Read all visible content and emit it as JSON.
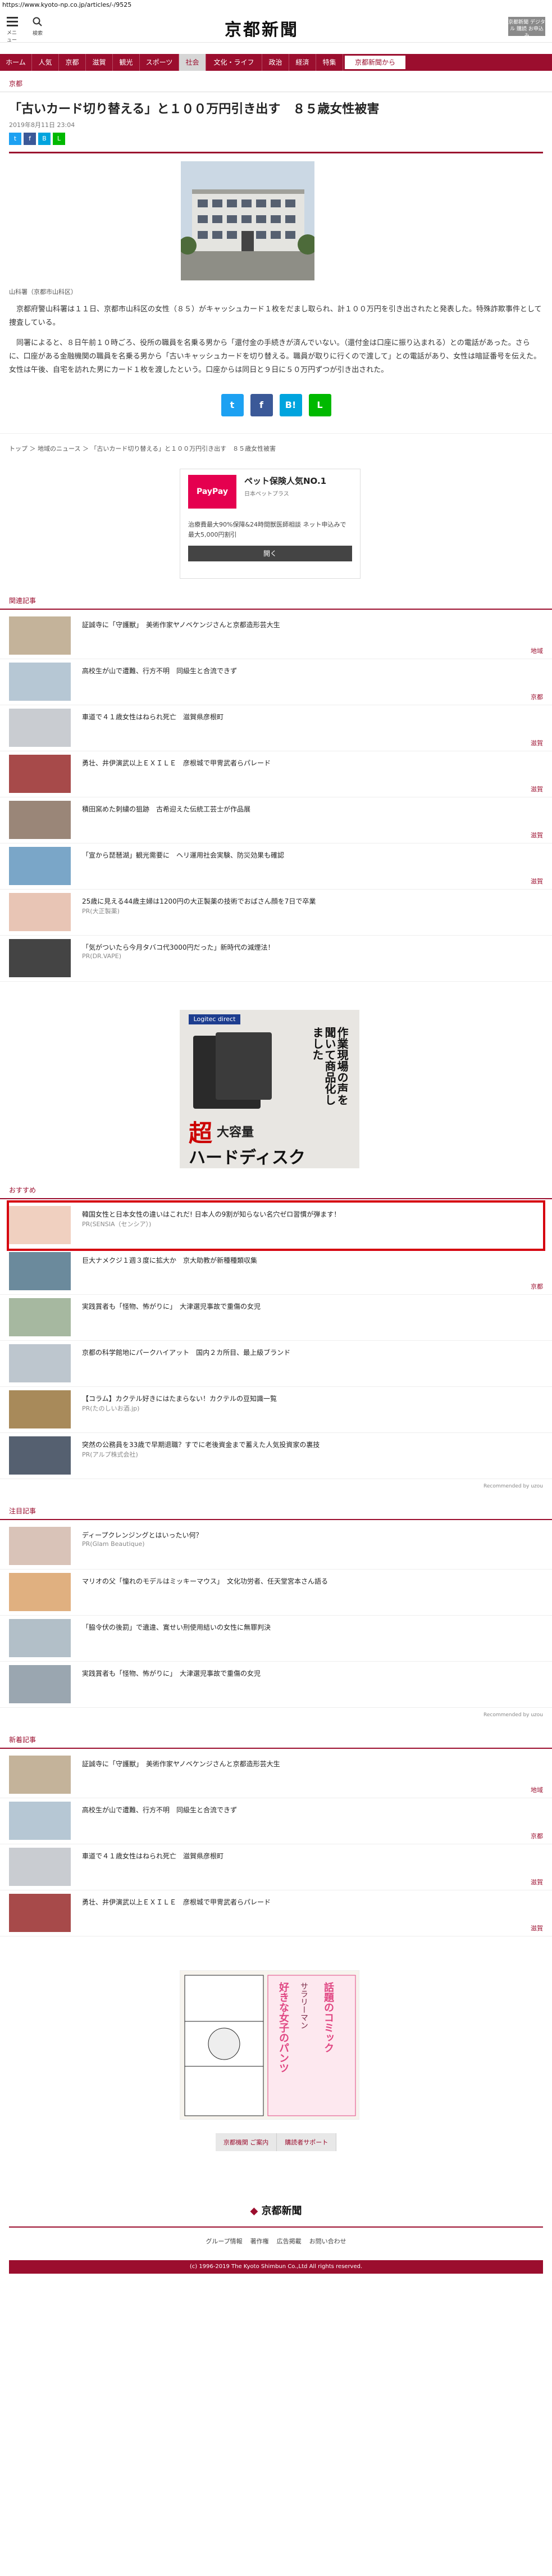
{
  "url": "https://www.kyoto-np.co.jp/articles/-/9525",
  "header": {
    "menu_label": "メニュー",
    "search_label": "検索",
    "logo": "京都新聞",
    "apply_label": "京都新聞 デジタル 購読 お申込み"
  },
  "nav": {
    "items": [
      "ホーム",
      "人気",
      "京都",
      "滋賀",
      "観光",
      "スポーツ",
      "社会",
      "文化・ライフ",
      "政治",
      "経済",
      "特集"
    ],
    "active": "社会",
    "special": "京都新聞から"
  },
  "article": {
    "section": "京都",
    "headline": "「古いカード切り替える」と１００万円引き出す　８５歳女性被害",
    "date": "2019年8月11日 23:04",
    "photo_caption": "山科署（京都市山科区）",
    "paragraphs": [
      "京都府警山科署は１１日、京都市山科区の女性（８５）がキャッシュカード１枚をだまし取られ、計１００万円を引き出されたと発表した。特殊詐欺事件として捜査している。",
      "同署によると、８日午前１０時ごろ、役所の職員を名乗る男から「還付金の手続きが済んでいない。（還付金は口座に振り込まれる）との電話があった。さらに、口座がある金融機関の職員を名乗る男から「古いキャッシュカードを切り替える。職員が取りに行くので渡して」との電話があり、女性は暗証番号を伝えた。女性は午後、自宅を訪れた男にカード１枚を渡したという。口座からは同日と９日に５０万円ずつが引き出された。"
    ],
    "breadcrumb": "トップ ＞ 地域のニュース ＞ 「古いカード切り替える」と１００万円引き出す　８５歳女性被害"
  },
  "ad_box": {
    "logo_text": "PayPay",
    "title": "ペット保険人気NO.1",
    "sub": "日本ペットプラス",
    "text": "治療費最大90%保障&24時間獣医師相談 ネット申込みで最大5,000円割引",
    "button": "開く"
  },
  "related": {
    "heading": "関連記事",
    "items": [
      {
        "title": "証誠寺に「守護獣」　美術作家ヤノベケンジさんと京都造形芸大生",
        "sub": "",
        "cat": "地域"
      },
      {
        "title": "高校生が山で遭難、行方不明　同級生と合流できず",
        "sub": "",
        "cat": "京都"
      },
      {
        "title": "車道で４１歳女性はねられ死亡　滋賀県彦根町",
        "sub": "",
        "cat": "滋賀"
      },
      {
        "title": "勇壮、井伊演武以上ＥＸＩＬＥ　彦根城で甲冑武者らパレード",
        "sub": "",
        "cat": "滋賀"
      },
      {
        "title": "積田窯めた刺繍の狙跡　古希迎えた伝統工芸士が作品展",
        "sub": "",
        "cat": "滋賀"
      },
      {
        "title": "「宣から琵琶湖」観光需要に　ヘリ運用社会実験、防災効果も確認",
        "sub": "",
        "cat": "滋賀"
      },
      {
        "title": "25歳に見える44歳主婦は1200円の大正製薬の技術でおばさん顔を7日で卒業",
        "sub": "PR(大正製薬)",
        "cat": ""
      },
      {
        "title": "「気がついたら今月タバコ代3000円だった」新時代の減煙法！",
        "sub": "PR(DR.VAPE)",
        "cat": ""
      }
    ]
  },
  "big_ad": {
    "brand": "Logitec direct",
    "vertical_text": "作業現場の声を聞いて商品化しました",
    "big_text": "超",
    "big_text2": "大容量",
    "big_text3": "ハードディスク"
  },
  "recommend": {
    "heading": "おすすめ",
    "items": [
      {
        "title": "韓国女性と日本女性の違いはこれだ! 日本人の9割が知らない名穴ゼロ習慣が弾ます！",
        "sub": "PR(SENSIA（センシア）)",
        "cat": "",
        "highlight": true
      },
      {
        "title": "巨大ナメクジ１週３度に拡大か　京大助教が新種種類収集",
        "sub": "",
        "cat": "京都"
      },
      {
        "title": "実践賞者も「怪物、怖がりに」　大津選児事故で重傷の女児",
        "sub": "",
        "cat": ""
      },
      {
        "title": "京都の科学館地にパークハイアット　国内２カ所目、最上級ブランド",
        "sub": "",
        "cat": ""
      },
      {
        "title": "【コラム】カクテル好きにはたまらない！カクテルの豆知識一覧",
        "sub": "PR(たのしいお酒.jp)",
        "cat": ""
      },
      {
        "title": "突然の公務員を33歳で早期退職？すでに老後資金まで蓄えた人気投資家の裏技",
        "sub": "PR(アルプ株式会社)",
        "cat": ""
      }
    ],
    "recommended_by": "Recommended by uzou"
  },
  "attention": {
    "heading": "注目記事",
    "items": [
      {
        "title": "ディープクレンジングとはいったい何？",
        "sub": "PR(Glam Beautique)",
        "cat": ""
      },
      {
        "title": "マリオの父「憧れのモデルはミッキーマウス」　文化功労者、任天堂宮本さん語る",
        "sub": "",
        "cat": ""
      },
      {
        "title": "「脇令伏の後罰」で遺違、寛せい刑使用結いの女性に無罪判決",
        "sub": "",
        "cat": ""
      },
      {
        "title": "実践賞者も「怪物、怖がりに」　大津選児事故で重傷の女児",
        "sub": "",
        "cat": ""
      }
    ],
    "recommended_by": "Recommended by uzou"
  },
  "newest": {
    "heading": "新着記事",
    "items": [
      {
        "title": "証誠寺に「守護獣」　美術作家ヤノベケンジさんと京都造形芸大生",
        "sub": "",
        "cat": "地域"
      },
      {
        "title": "高校生が山で遭難、行方不明　同級生と合流できず",
        "sub": "",
        "cat": "京都"
      },
      {
        "title": "車道で４１歳女性はねられ死亡　滋賀県彦根町",
        "sub": "",
        "cat": "滋賀"
      },
      {
        "title": "勇壮、井伊演武以上ＥＸＩＬＥ　彦根城で甲冑武者らパレード",
        "sub": "",
        "cat": "滋賀"
      }
    ]
  },
  "bottom_ad": {
    "left_text": "好きな女子のパンツ",
    "right_text": "話題のコミック",
    "sub": "サラリーマン"
  },
  "footer": {
    "links": [
      "京都機関 ご案内",
      "購読者サポート"
    ],
    "logo": "京都新聞",
    "nav": [
      "グループ情報",
      "著作権",
      "広告掲載",
      "お問い合わせ"
    ],
    "copyright": "(c) 1996-2019 The Kyoto Shimbun Co.,Ltd All rights reserved."
  },
  "colors": {
    "brand": "#9b0e2e",
    "highlight": "#d6000f"
  }
}
